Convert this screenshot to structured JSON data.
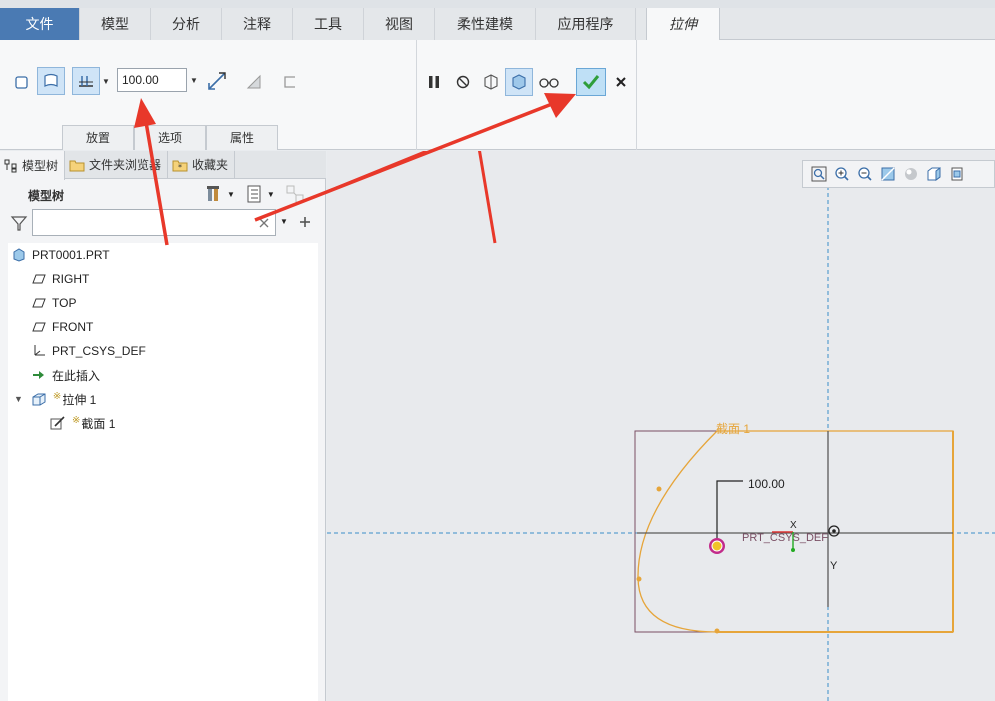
{
  "tabs": {
    "file": "文件",
    "model": "模型",
    "analysis": "分析",
    "annotate": "注释",
    "tools": "工具",
    "view": "视图",
    "flexible": "柔性建模",
    "apps": "应用程序",
    "extrude": "拉伸"
  },
  "ribbon": {
    "depth_value": "100.00",
    "sub_tabs": [
      "放置",
      "选项",
      "属性"
    ]
  },
  "left_pane": {
    "tabs": [
      "模型树",
      "文件夹浏览器",
      "收藏夹"
    ],
    "tree_title": "模型树",
    "search_placeholder": ""
  },
  "tree": {
    "root": "PRT0001.PRT",
    "items": [
      "RIGHT",
      "TOP",
      "FRONT",
      "PRT_CSYS_DEF",
      "在此插入"
    ],
    "feature": "拉伸 1",
    "feature_child": "截面 1",
    "feature_mark": "※"
  },
  "canvas": {
    "section_label": "截面 1",
    "dimension": "100.00",
    "csys_label": "PRT_CSYS_DEF",
    "axis_x": "X",
    "axis_y": "Y"
  },
  "colors": {
    "file_tab": "#4a7ab3",
    "sketch": "#e6a53a",
    "frame": "#7a4f64",
    "arrow": "#e8382a",
    "confirm": "#2f9e3a"
  }
}
